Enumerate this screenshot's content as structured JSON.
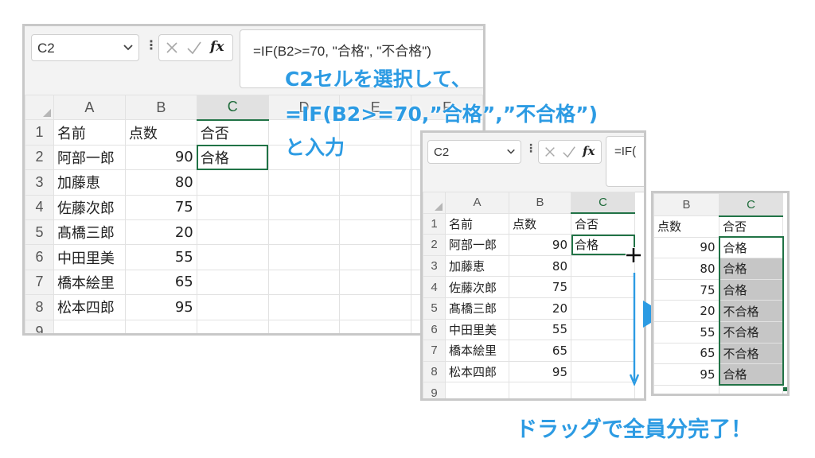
{
  "left_panel": {
    "name_box": "C2",
    "formula": "=IF(B2>=70, \"合格\", \"不合格\")",
    "columns": [
      "A",
      "B",
      "C",
      "D",
      "E",
      "F"
    ],
    "rows": [
      {
        "num": "1",
        "a": "名前",
        "b": "点数",
        "c": "合否"
      },
      {
        "num": "2",
        "a": "阿部一郎",
        "b": "90",
        "c": "合格"
      },
      {
        "num": "3",
        "a": "加藤恵",
        "b": "80",
        "c": ""
      },
      {
        "num": "4",
        "a": "佐藤次郎",
        "b": "75",
        "c": ""
      },
      {
        "num": "5",
        "a": "髙橋三郎",
        "b": "20",
        "c": ""
      },
      {
        "num": "6",
        "a": "中田里美",
        "b": "55",
        "c": ""
      },
      {
        "num": "7",
        "a": "橋本絵里",
        "b": "65",
        "c": ""
      },
      {
        "num": "8",
        "a": "松本四郎",
        "b": "95",
        "c": ""
      },
      {
        "num": "9",
        "a": "",
        "b": "",
        "c": ""
      }
    ]
  },
  "middle_panel": {
    "name_box": "C2",
    "formula": "=IF(",
    "columns": [
      "A",
      "B",
      "C"
    ],
    "rows": [
      {
        "num": "1",
        "a": "名前",
        "b": "点数",
        "c": "合否"
      },
      {
        "num": "2",
        "a": "阿部一郎",
        "b": "90",
        "c": "合格"
      },
      {
        "num": "3",
        "a": "加藤恵",
        "b": "80",
        "c": ""
      },
      {
        "num": "4",
        "a": "佐藤次郎",
        "b": "75",
        "c": ""
      },
      {
        "num": "5",
        "a": "髙橋三郎",
        "b": "20",
        "c": ""
      },
      {
        "num": "6",
        "a": "中田里美",
        "b": "55",
        "c": ""
      },
      {
        "num": "7",
        "a": "橋本絵里",
        "b": "65",
        "c": ""
      },
      {
        "num": "8",
        "a": "松本四郎",
        "b": "95",
        "c": ""
      },
      {
        "num": "9",
        "a": "",
        "b": "",
        "c": ""
      }
    ]
  },
  "right_panel": {
    "columns": [
      "B",
      "C"
    ],
    "rows": [
      {
        "b": "点数",
        "c": "合否"
      },
      {
        "b": "90",
        "c": "合格"
      },
      {
        "b": "80",
        "c": "合格"
      },
      {
        "b": "75",
        "c": "合格"
      },
      {
        "b": "20",
        "c": "不合格"
      },
      {
        "b": "55",
        "c": "不合格"
      },
      {
        "b": "65",
        "c": "不合格"
      },
      {
        "b": "95",
        "c": "合格"
      }
    ]
  },
  "callouts": {
    "line1": "C2セルを選択して、",
    "line2": "=IF(B2>=70,”合格”,”不合格”)",
    "line3": "と入力",
    "done": "ドラッグで全員分完了！"
  },
  "icons": {
    "fill_cursor": "fill-handle-plus-icon",
    "drag_arrow": "drag-down-arrow-icon",
    "next_arrow": "play-triangle-icon"
  },
  "colors": {
    "accent": "#2c9be3",
    "selection": "#217346",
    "filled": "#c6c6c6"
  }
}
